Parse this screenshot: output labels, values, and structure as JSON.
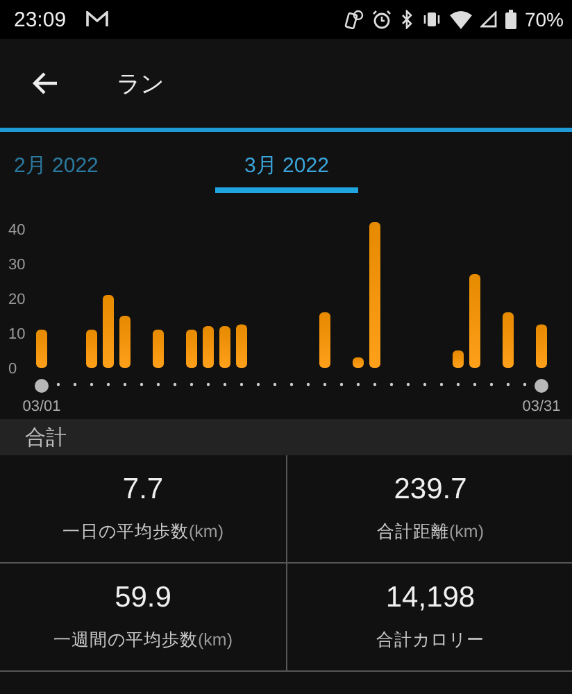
{
  "status_bar": {
    "time": "23:09",
    "battery": "70%"
  },
  "app_bar": {
    "title": "ラン"
  },
  "tabs": [
    {
      "label": "2月 2022",
      "selected": false
    },
    {
      "label": "3月 2022",
      "selected": true
    }
  ],
  "chart_data": {
    "type": "bar",
    "categories": [
      "03/01",
      null,
      null,
      null,
      null,
      null,
      null,
      null,
      null,
      null,
      null,
      null,
      null,
      null,
      null,
      null,
      null,
      null,
      null,
      null,
      null,
      null,
      null,
      null,
      null,
      null,
      null,
      null,
      null,
      null,
      "03/31"
    ],
    "values": [
      11,
      null,
      null,
      11,
      21,
      15,
      null,
      11,
      null,
      11,
      12,
      12,
      12.5,
      null,
      null,
      null,
      null,
      16,
      null,
      3,
      42,
      null,
      null,
      null,
      null,
      5,
      27,
      null,
      16,
      null,
      12.5
    ],
    "ylim": [
      0,
      42
    ],
    "yticks": [
      0,
      10,
      20,
      30,
      40
    ]
  },
  "summary": {
    "title": "合計",
    "stats": [
      {
        "value": "7.7",
        "label": "一日の平均歩数",
        "unit": "(km)"
      },
      {
        "value": "239.7",
        "label": "合計距離",
        "unit": "(km)"
      },
      {
        "value": "59.9",
        "label": "一週間の平均歩数",
        "unit": "(km)"
      },
      {
        "value": "14,198",
        "label": "合計カロリー"
      }
    ]
  }
}
